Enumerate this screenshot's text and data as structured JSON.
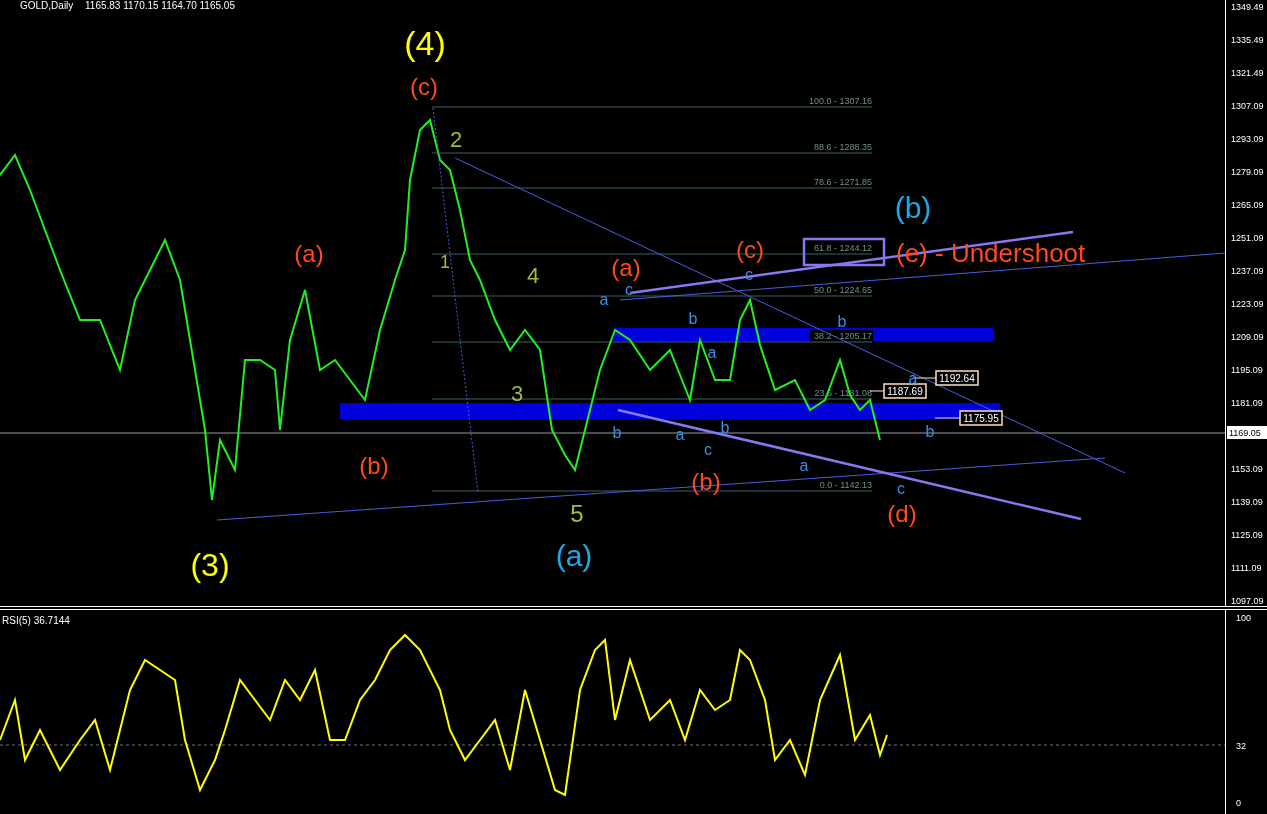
{
  "header": {
    "symbol": "GOLD,Daily",
    "ohlc": "1165.83 1170.15 1164.70 1165.05"
  },
  "price_axis": [
    "1349.49",
    "1335.49",
    "1321.49",
    "1307.09",
    "1293.09",
    "1279.09",
    "1265.09",
    "1251.09",
    "1237.09",
    "1223.09",
    "1209.09",
    "1195.09",
    "1181.09",
    "1153.09",
    "1139.09",
    "1125.09",
    "1111.09",
    "1097.09"
  ],
  "current_price": "1169.05",
  "fib_levels": [
    "100.0 - 1307.16",
    "88.6 - 1288.35",
    "78.6 - 1271.85",
    "61.8 - 1244.12",
    "50.0 - 1224.65",
    "38.2 - 1205.17",
    "23.6 - 1181.08",
    "0.0 - 1142.13"
  ],
  "price_tags": [
    "1192.64",
    "1187.69",
    "1175.95"
  ],
  "wave_labels": [
    {
      "text": "(4)",
      "color": "#ffff00"
    },
    {
      "text": "(c)",
      "color": "#ff4a1c"
    },
    {
      "text": "2",
      "color": "#a8b83a"
    },
    {
      "text": "(b)",
      "color": "#1fa8e8"
    },
    {
      "text": "(a)",
      "color": "#ff4a1c"
    },
    {
      "text": "1",
      "color": "#a8b83a"
    },
    {
      "text": "4",
      "color": "#a8b83a"
    },
    {
      "text": "a",
      "color": "#3a8ee6"
    },
    {
      "text": "(a)",
      "color": "#ff4a1c"
    },
    {
      "text": "c",
      "color": "#3a8ee6"
    },
    {
      "text": "(c)",
      "color": "#ff4a1c"
    },
    {
      "text": "c",
      "color": "#3a8ee6"
    },
    {
      "text": "(e) - Undershoot",
      "color": "#ff4a1c"
    },
    {
      "text": "b",
      "color": "#3a8ee6"
    },
    {
      "text": "b",
      "color": "#3a8ee6"
    },
    {
      "text": "a",
      "color": "#3a8ee6"
    },
    {
      "text": "a",
      "color": "#3a8ee6"
    },
    {
      "text": "3",
      "color": "#a8b83a"
    },
    {
      "text": "b",
      "color": "#3a8ee6"
    },
    {
      "text": "a",
      "color": "#3a8ee6"
    },
    {
      "text": "b",
      "color": "#3a8ee6"
    },
    {
      "text": "b",
      "color": "#3a8ee6"
    },
    {
      "text": "(b)",
      "color": "#ff4a1c"
    },
    {
      "text": "c",
      "color": "#3a8ee6"
    },
    {
      "text": "(b)",
      "color": "#ff4a1c"
    },
    {
      "text": "a",
      "color": "#3a8ee6"
    },
    {
      "text": "c",
      "color": "#3a8ee6"
    },
    {
      "text": "5",
      "color": "#a8b83a"
    },
    {
      "text": "(d)",
      "color": "#ff4a1c"
    },
    {
      "text": "(3)",
      "color": "#ffff00"
    },
    {
      "text": "(a)",
      "color": "#1fa8e8"
    }
  ],
  "rsi": {
    "label": "RSI(5) 36.7144",
    "axis": [
      "100",
      "32",
      "0"
    ]
  }
}
